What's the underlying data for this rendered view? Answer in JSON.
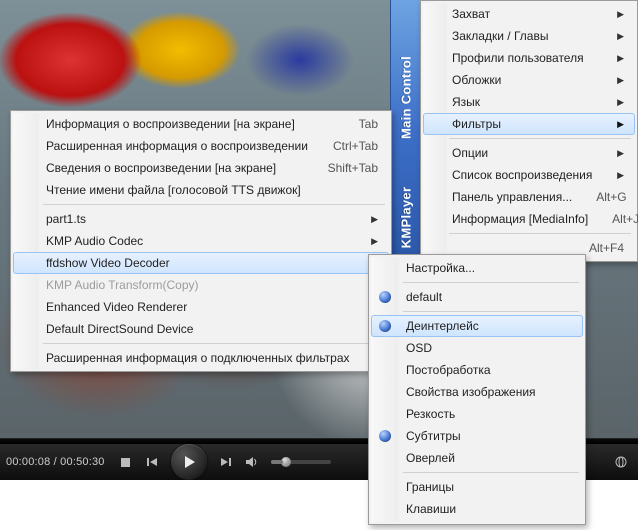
{
  "app": {
    "vert_label_1": "KMPlayer",
    "vert_label_2": "Main    Control"
  },
  "player": {
    "time_elapsed": "00:00:08",
    "time_total": "00:50:30",
    "time_combined": "00:00:08 / 00:50:30"
  },
  "menuA": {
    "items": [
      {
        "type": "item",
        "label": "Информация о воспроизведении [на экране]",
        "shortcut": "Tab"
      },
      {
        "type": "item",
        "label": "Расширенная информация о воспроизведении",
        "shortcut": "Ctrl+Tab"
      },
      {
        "type": "item",
        "label": "Сведения о воспроизведении [на экране]",
        "shortcut": "Shift+Tab"
      },
      {
        "type": "item",
        "label": "Чтение имени файла [голосовой TTS движок]"
      },
      {
        "type": "sep"
      },
      {
        "type": "item",
        "label": "part1.ts",
        "arrow": true
      },
      {
        "type": "item",
        "label": "KMP Audio Codec",
        "arrow": true
      },
      {
        "type": "item",
        "label": "ffdshow Video Decoder",
        "arrow": true,
        "highlight": true
      },
      {
        "type": "item-disabled",
        "label": "KMP Audio Transform(Copy)"
      },
      {
        "type": "item",
        "label": "Enhanced Video Renderer",
        "arrow": true
      },
      {
        "type": "item",
        "label": "Default DirectSound Device",
        "arrow": true
      },
      {
        "type": "sep"
      },
      {
        "type": "item",
        "label": "Расширенная информация о подключенных фильтрах"
      }
    ]
  },
  "menuB": {
    "items": [
      {
        "type": "item",
        "label": "Захват",
        "arrow": true
      },
      {
        "type": "item",
        "label": "Закладки / Главы",
        "arrow": true
      },
      {
        "type": "item",
        "label": "Профили пользователя",
        "arrow": true
      },
      {
        "type": "item",
        "label": "Обложки",
        "arrow": true
      },
      {
        "type": "item",
        "label": "Язык",
        "arrow": true
      },
      {
        "type": "item",
        "label": "Фильтры",
        "arrow": true,
        "highlight": true
      },
      {
        "type": "sep"
      },
      {
        "type": "item",
        "label": "Опции",
        "arrow": true
      },
      {
        "type": "item",
        "label": "Список воспроизведения",
        "arrow": true
      },
      {
        "type": "item",
        "label": "Панель управления...",
        "shortcut": "Alt+G"
      },
      {
        "type": "item",
        "label": "Информация [MediaInfo]",
        "shortcut": "Alt+J"
      },
      {
        "type": "sep-partial"
      },
      {
        "type": "item-partial",
        "shortcut": "Alt+F4"
      }
    ]
  },
  "menuC": {
    "items": [
      {
        "type": "item",
        "label": "Настройка..."
      },
      {
        "type": "sep"
      },
      {
        "type": "item",
        "label": "default",
        "radio": true
      },
      {
        "type": "sep"
      },
      {
        "type": "item",
        "label": "Деинтерлейс",
        "radio": true,
        "highlight": true
      },
      {
        "type": "item",
        "label": "OSD"
      },
      {
        "type": "item",
        "label": "Постобработка"
      },
      {
        "type": "item",
        "label": "Свойства изображения"
      },
      {
        "type": "item",
        "label": "Резкость"
      },
      {
        "type": "item",
        "label": "Субтитры",
        "radio": true
      },
      {
        "type": "item",
        "label": "Оверлей"
      },
      {
        "type": "sep"
      },
      {
        "type": "item",
        "label": "Границы"
      },
      {
        "type": "item",
        "label": "Клавиши"
      }
    ]
  }
}
